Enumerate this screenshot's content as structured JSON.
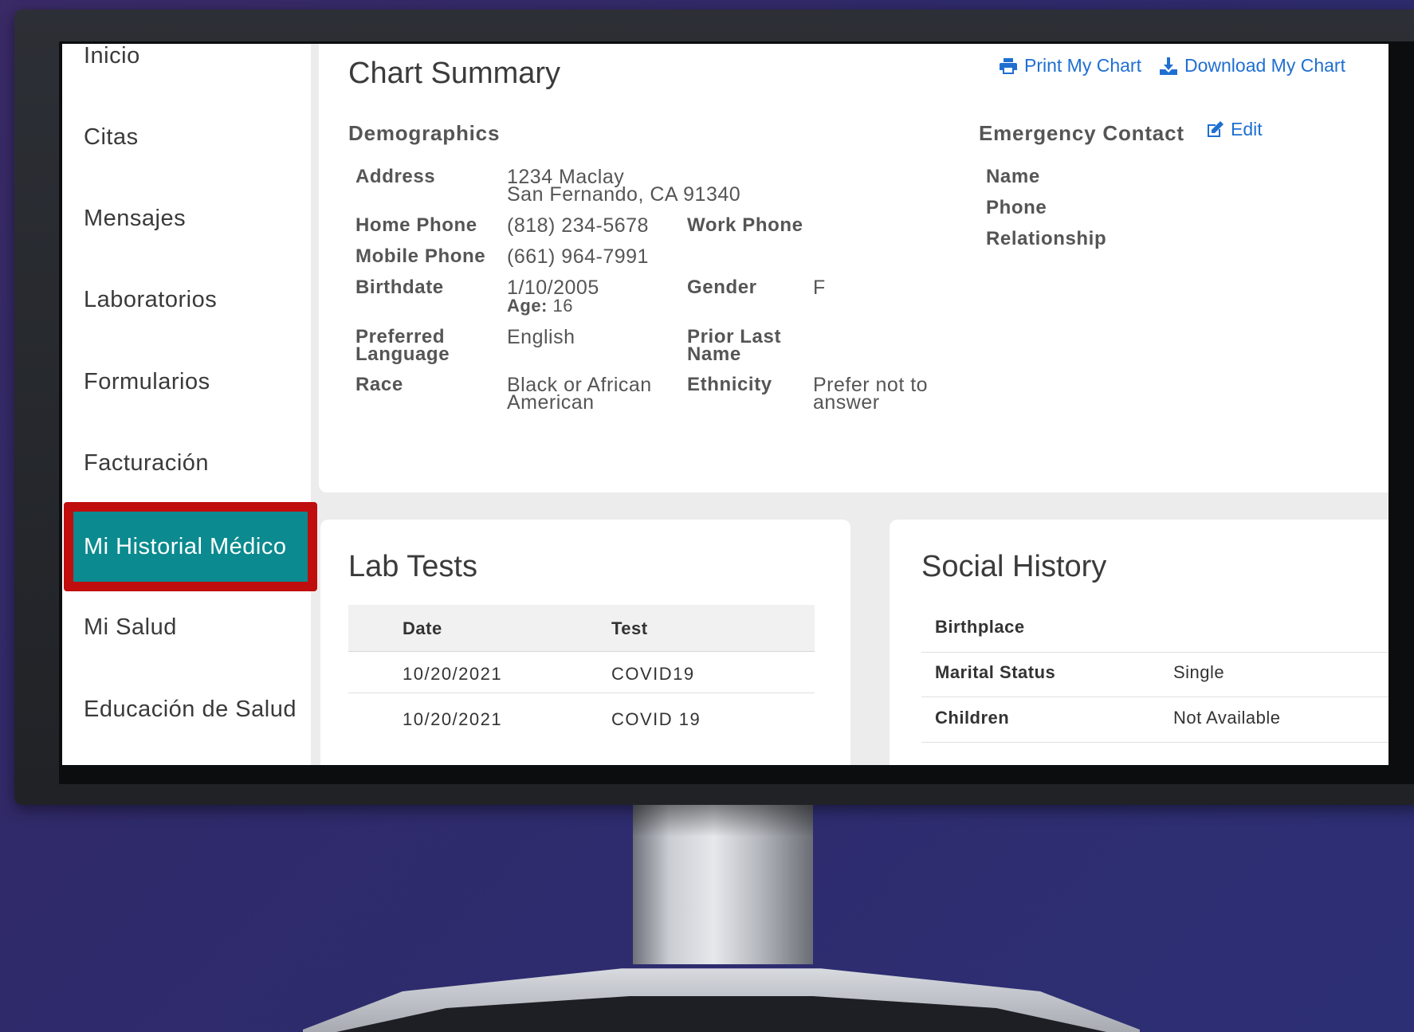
{
  "sidebar": {
    "items": [
      {
        "label": "Inicio"
      },
      {
        "label": "Citas"
      },
      {
        "label": "Mensajes"
      },
      {
        "label": "Laboratorios"
      },
      {
        "label": "Formularios"
      },
      {
        "label": "Facturación"
      },
      {
        "label": "Mi Historial Médico",
        "active": true
      },
      {
        "label": "Mi Salud"
      },
      {
        "label": "Educación de Salud"
      }
    ]
  },
  "chart_summary": {
    "title": "Chart Summary",
    "print_label": "Print My Chart",
    "download_label": "Download My Chart",
    "demographics": {
      "heading": "Demographics",
      "address_label": "Address",
      "address_line1": "1234 Maclay",
      "address_line2": "San Fernando, CA 91340",
      "home_phone_label": "Home Phone",
      "home_phone": "(818) 234-5678",
      "work_phone_label": "Work Phone",
      "mobile_phone_label": "Mobile Phone",
      "mobile_phone": "(661) 964-7991",
      "birthdate_label": "Birthdate",
      "birthdate": "1/10/2005",
      "age_label": "Age:",
      "age": "16",
      "gender_label": "Gender",
      "gender": "F",
      "language_label_1": "Preferred",
      "language_label_2": "Language",
      "language": "English",
      "prior_name_label_1": "Prior Last",
      "prior_name_label_2": "Name",
      "race_label": "Race",
      "race_1": "Black or African",
      "race_2": "American",
      "ethnicity_label": "Ethnicity",
      "ethnicity_1": "Prefer not to",
      "ethnicity_2": "answer"
    },
    "emergency": {
      "heading": "Emergency Contact",
      "edit_label": "Edit",
      "name_label": "Name",
      "phone_label": "Phone",
      "relationship_label": "Relationship"
    }
  },
  "lab_tests": {
    "title": "Lab Tests",
    "columns": [
      "Date",
      "Test"
    ],
    "rows": [
      [
        "10/20/2021",
        "COVID19"
      ],
      [
        "10/20/2021",
        "COVID 19"
      ]
    ]
  },
  "social_history": {
    "title": "Social History",
    "rows": [
      {
        "label": "Birthplace",
        "value": ""
      },
      {
        "label": "Marital Status",
        "value": "Single"
      },
      {
        "label": "Children",
        "value": "Not Available"
      }
    ]
  },
  "colors": {
    "accent": "#0b8a8f",
    "highlight": "#c00d0d",
    "link": "#1f6fd1"
  },
  "icons": [
    "print-icon",
    "download-icon",
    "edit-icon"
  ]
}
